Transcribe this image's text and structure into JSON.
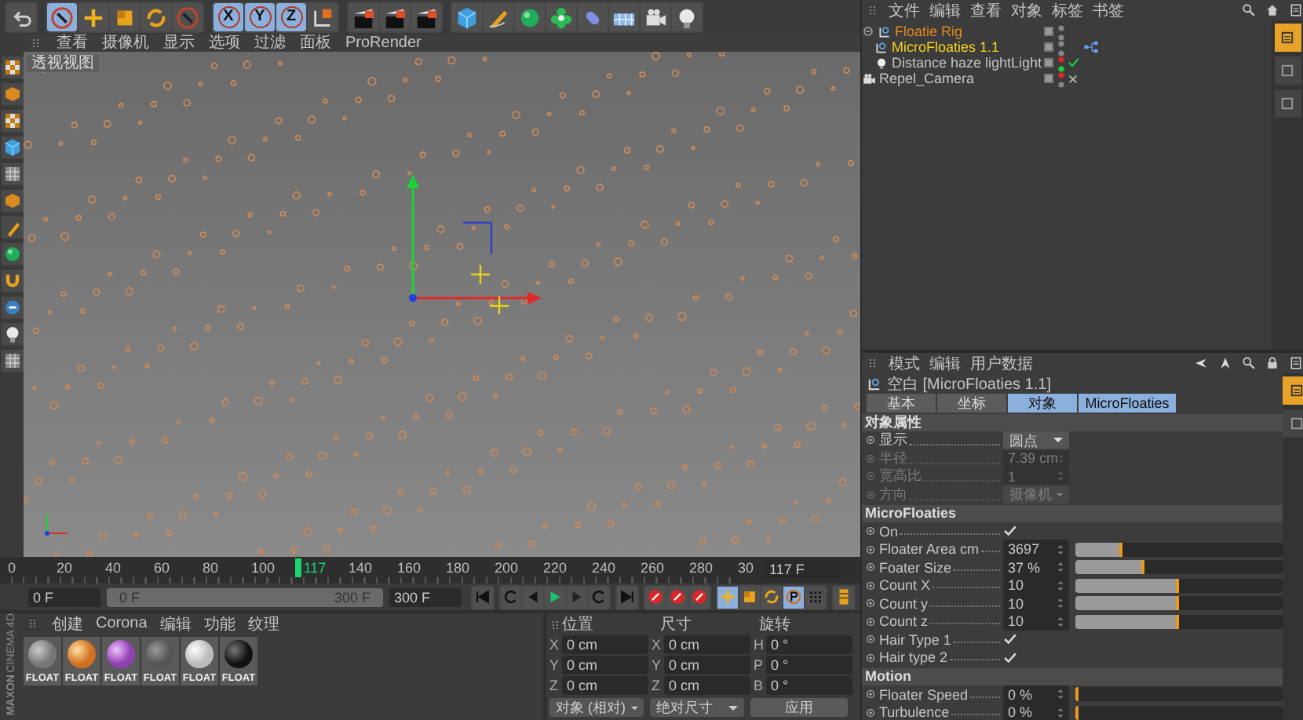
{
  "toolbar": {
    "groups": [
      [
        {
          "kind": "undo"
        }
      ],
      [
        {
          "kind": "pointer",
          "selected": true
        },
        {
          "kind": "move",
          "selected": false
        },
        {
          "kind": "scale",
          "selected": false
        },
        {
          "kind": "rotate",
          "selected": false
        },
        {
          "kind": "pointer",
          "selected": false
        }
      ],
      [
        {
          "kind": "axis",
          "label": "X",
          "selected": true
        },
        {
          "kind": "axis",
          "label": "Y",
          "selected": true
        },
        {
          "kind": "axis",
          "label": "Z",
          "selected": true
        },
        {
          "kind": "coord",
          "selected": false
        }
      ],
      [
        {
          "kind": "render"
        },
        {
          "kind": "render"
        },
        {
          "kind": "render"
        }
      ],
      [
        {
          "kind": "cube"
        },
        {
          "kind": "pen"
        },
        {
          "kind": "sphere"
        },
        {
          "kind": "flower"
        },
        {
          "kind": "capsule"
        },
        {
          "kind": "floor"
        },
        {
          "kind": "camera"
        },
        {
          "kind": "bulb"
        }
      ]
    ]
  },
  "side_tools": [
    {
      "kind": "checker"
    },
    {
      "kind": "box"
    },
    {
      "kind": "checker"
    },
    {
      "kind": "cube"
    },
    {
      "kind": "grid"
    },
    {
      "kind": "box"
    },
    {
      "kind": "brush"
    },
    {
      "kind": "sphere"
    },
    {
      "kind": "magnet"
    },
    {
      "kind": "snap"
    },
    {
      "kind": "bulb"
    },
    {
      "kind": "grid"
    }
  ],
  "viewport": {
    "menu": [
      "查看",
      "摄像机",
      "显示",
      "选项",
      "过滤",
      "面板",
      "ProRender"
    ],
    "label": "透视视图"
  },
  "timeline": {
    "ticks_before": [
      "0",
      "20",
      "40",
      "60",
      "80",
      "100"
    ],
    "ticks_after": [
      "140",
      "160",
      "180",
      "200",
      "220",
      "240",
      "260",
      "280",
      "30"
    ],
    "playhead": {
      "label": "117",
      "level": 0.39
    },
    "current_frame": "117 F",
    "start": "0 F",
    "range": {
      "start": "0 F",
      "end": "300 F",
      "level": 1
    },
    "end": "300 F"
  },
  "transport": {
    "groups": [
      [
        {
          "kind": "go-start"
        }
      ],
      [
        {
          "kind": "loop"
        },
        {
          "kind": "step-back"
        },
        {
          "kind": "play"
        },
        {
          "kind": "step-forward"
        },
        {
          "kind": "loop"
        }
      ],
      [
        {
          "kind": "go-end"
        }
      ],
      [
        {
          "kind": "record"
        },
        {
          "kind": "record"
        },
        {
          "kind": "record"
        }
      ],
      [
        {
          "kind": "move",
          "selected": true
        },
        {
          "kind": "scale",
          "selected": false
        },
        {
          "kind": "rotate",
          "selected": false
        },
        {
          "kind": "param",
          "selected": true
        },
        {
          "kind": "dots",
          "selected": false
        }
      ],
      [
        {
          "kind": "timeline"
        }
      ]
    ]
  },
  "materials": {
    "menu": [
      "创建",
      "Corona",
      "编辑",
      "功能",
      "纹理"
    ],
    "logo": [
      "MAXON",
      "CINEMA 4D"
    ],
    "items": [
      {
        "name": "FLOAT",
        "kind": "chrome"
      },
      {
        "name": "FLOAT",
        "kind": "fire"
      },
      {
        "name": "FLOAT",
        "kind": "glow"
      },
      {
        "name": "FLOAT",
        "kind": "wire"
      },
      {
        "name": "FLOAT",
        "kind": "white"
      },
      {
        "name": "FLOAT",
        "kind": "black"
      }
    ]
  },
  "coordinates": {
    "headers": [
      "位置",
      "尺寸",
      "旋转"
    ],
    "rows": [
      [
        {
          "axis": "X",
          "value": "0 cm"
        },
        {
          "axis": "X",
          "value": "0 cm"
        },
        {
          "axis": "H",
          "value": "0 °"
        }
      ],
      [
        {
          "axis": "Y",
          "value": "0 cm"
        },
        {
          "axis": "Y",
          "value": "0 cm"
        },
        {
          "axis": "P",
          "value": "0 °"
        }
      ],
      [
        {
          "axis": "Z",
          "value": "0 cm"
        },
        {
          "axis": "Z",
          "value": "0 cm"
        },
        {
          "axis": "B",
          "value": "0 °"
        }
      ]
    ],
    "dropdowns": [
      "对象 (相对)",
      "绝对尺寸"
    ],
    "apply": "应用"
  },
  "object_manager": {
    "menu": [
      "文件",
      "编辑",
      "查看",
      "对象",
      "标签",
      "书签"
    ],
    "objects": [
      {
        "name": "Floatie Rig",
        "kind": "null",
        "selected": false,
        "contains_selection": true,
        "expanded": true,
        "hidden_in_editor": false,
        "render_forced": false,
        "children": [
          {
            "name": "MicroFloaties 1.1",
            "kind": "null",
            "selected": true,
            "contains_selection": false,
            "hidden_in_editor": false,
            "render_forced": false,
            "tagged": true
          },
          {
            "name": "Distance haze lightLight",
            "kind": "light",
            "selected": false,
            "contains_selection": false,
            "hidden_in_editor": true,
            "render_forced": true,
            "enabled": true
          }
        ]
      },
      {
        "name": "Repel_Camera",
        "kind": "camera",
        "selected": false,
        "contains_selection": false,
        "hidden_in_editor": true,
        "render_forced": false,
        "enabled": false
      }
    ],
    "side_tabs": [
      {
        "selected": true
      },
      {
        "selected": false
      },
      {
        "selected": false
      }
    ]
  },
  "attributes": {
    "menu": [
      "模式",
      "编辑",
      "用户数据"
    ],
    "title": "空白 [MicroFloaties 1.1]",
    "tabs": [
      {
        "label": "基本",
        "selected": false
      },
      {
        "label": "坐标",
        "selected": false
      },
      {
        "label": "对象",
        "selected": true
      },
      {
        "label": "MicroFloaties",
        "selected": true
      }
    ],
    "side_tabs": [
      {
        "selected": true
      },
      {
        "selected": false
      }
    ],
    "sections": [
      {
        "title": "对象属性",
        "rows": [
          {
            "kind": "dropdown",
            "label": "显示",
            "value": "圆点",
            "disabled": false
          },
          {
            "kind": "number",
            "label": "半径",
            "value": "7.39 cm",
            "disabled": true
          },
          {
            "kind": "number",
            "label": "宽高比",
            "value": "1",
            "disabled": true
          },
          {
            "kind": "dropdown",
            "label": "方向",
            "value": "摄像机",
            "disabled": true
          }
        ]
      },
      {
        "title": "MicroFloaties",
        "rows": [
          {
            "kind": "checkbox",
            "label": "On",
            "checked": true,
            "disabled": false
          },
          {
            "kind": "slider",
            "label": "Floater Area cm",
            "value": "3697",
            "level": 0.23,
            "disabled": false
          },
          {
            "kind": "slider",
            "label": "Foater Size",
            "value": "37 %",
            "level": 0.33,
            "disabled": false
          },
          {
            "kind": "slider",
            "label": "Count X",
            "value": "10",
            "level": 0.5,
            "disabled": false
          },
          {
            "kind": "slider",
            "label": "Count y",
            "value": "10",
            "level": 0.5,
            "disabled": false
          },
          {
            "kind": "slider",
            "label": "Count z",
            "value": "10",
            "level": 0.5,
            "disabled": false
          },
          {
            "kind": "checkbox",
            "label": "Hair Type 1",
            "checked": true,
            "disabled": false
          },
          {
            "kind": "checkbox",
            "label": "Hair type 2",
            "checked": true,
            "disabled": false
          }
        ]
      },
      {
        "title": "Motion",
        "rows": [
          {
            "kind": "slider",
            "label": "Floater Speed",
            "value": "0 %",
            "level": 0,
            "disabled": false
          },
          {
            "kind": "slider",
            "label": "Turbulence",
            "value": "0 %",
            "level": 0,
            "disabled": false
          }
        ]
      }
    ]
  }
}
